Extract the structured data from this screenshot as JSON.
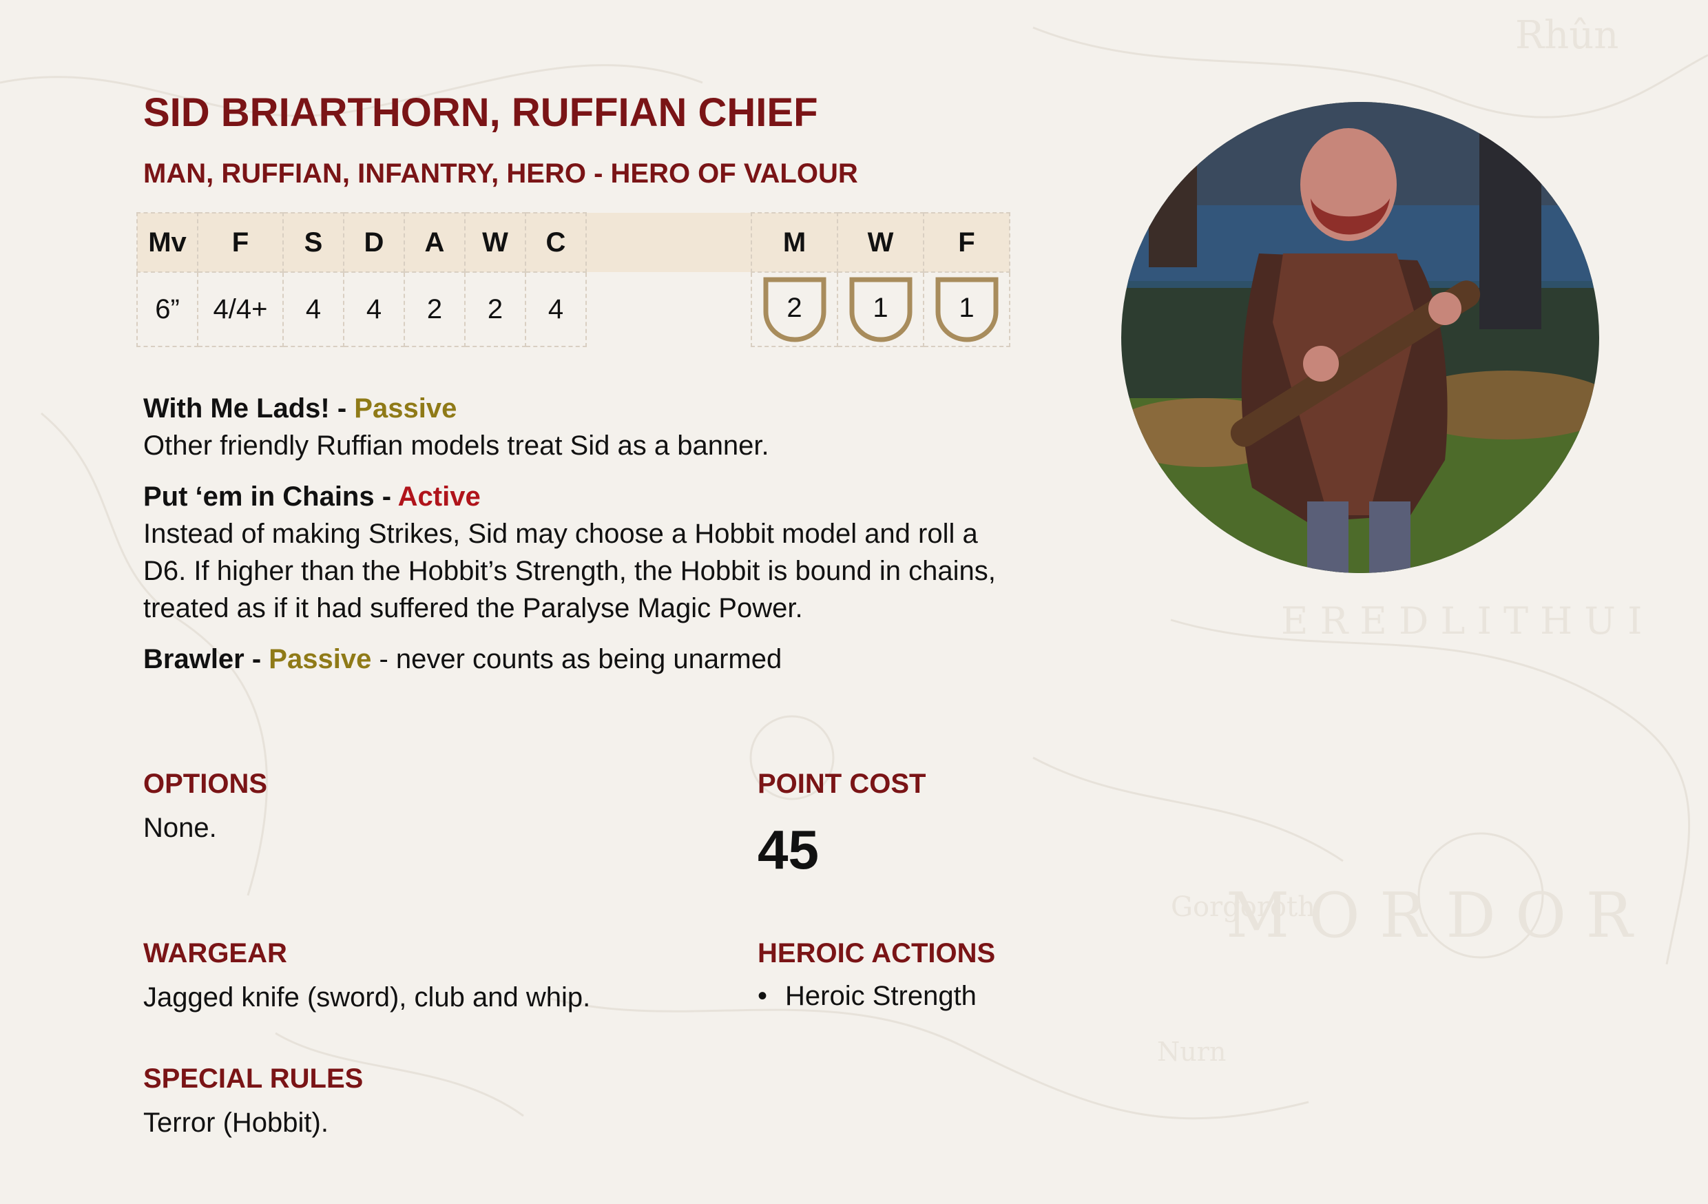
{
  "profile": {
    "name": "SID BRIARTHORN, RUFFIAN CHIEF",
    "keywords": "MAN, RUFFIAN, INFANTRY, HERO - HERO OF VALOUR"
  },
  "stats": {
    "headers": [
      "Mv",
      "F",
      "S",
      "D",
      "A",
      "W",
      "C"
    ],
    "values": [
      "6”",
      "4/4+",
      "4",
      "4",
      "2",
      "2",
      "4"
    ]
  },
  "heroic_stats": {
    "headers": [
      "M",
      "W",
      "F"
    ],
    "values": [
      "2",
      "1",
      "1"
    ]
  },
  "rules": [
    {
      "name": "With Me Lads!",
      "sep": " - ",
      "type": "Passive",
      "desc": "Other friendly Ruffian models treat Sid as a banner."
    },
    {
      "name": "Put ‘em in Chains",
      "sep": " - ",
      "type": "Active",
      "desc": "Instead of making Strikes, Sid may choose a Hobbit model and roll a D6. If higher than the Hobbit’s Strength, the Hobbit is bound in chains, treated as if it had suffered the Paralyse Magic Power."
    },
    {
      "name": "Brawler",
      "sep": " - ",
      "type": "Passive",
      "desc": " - never counts as being unarmed"
    }
  ],
  "options": {
    "heading": "OPTIONS",
    "text": "None."
  },
  "point_cost": {
    "heading": "POINT COST",
    "value": "45"
  },
  "wargear": {
    "heading": "WARGEAR",
    "text": "Jagged knife (sword), club and whip."
  },
  "heroic_actions": {
    "heading": "HEROIC ACTIONS",
    "items": [
      "Heroic Strength"
    ]
  },
  "special_rules": {
    "heading": "SPECIAL RULES",
    "text": "Terror (Hobbit)."
  },
  "colors": {
    "heading": "#7a1416",
    "passive": "#8f7a17",
    "active": "#b0141b",
    "table_header": "#f1e6d6",
    "shield": "#a88c5c",
    "background": "#f4f1ec"
  },
  "icons": [
    "might-shield-icon",
    "will-shield-icon",
    "fate-shield-icon"
  ]
}
